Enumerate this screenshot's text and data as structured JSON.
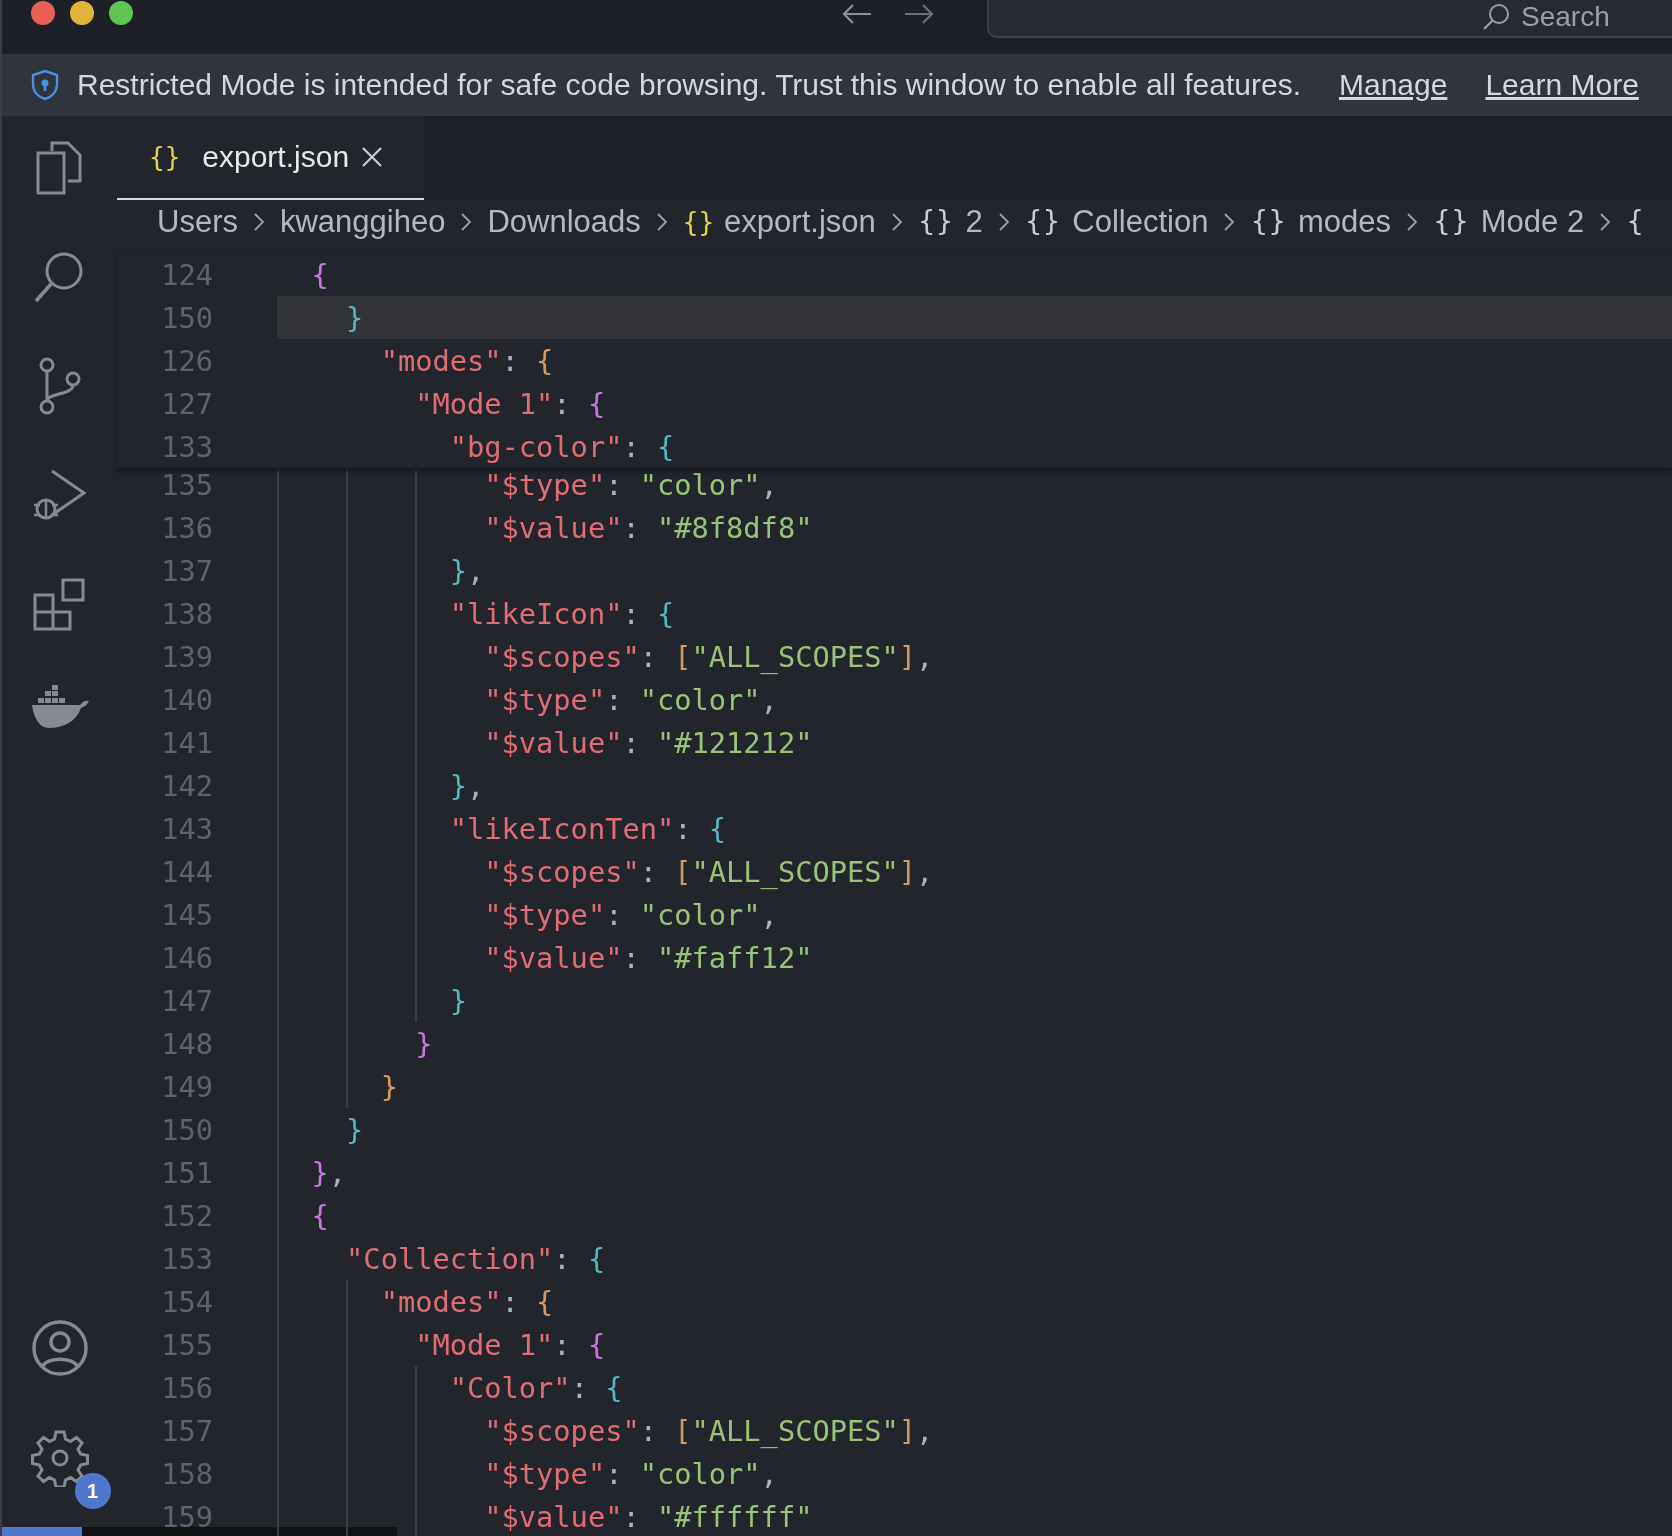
{
  "title_bar": {
    "search": {
      "placeholder": "Search"
    }
  },
  "banner": {
    "message": "Restricted Mode is intended for safe code browsing. Trust this window to enable all features.",
    "links": [
      "Manage",
      "Learn More"
    ]
  },
  "activity_bar": {
    "badge": "1"
  },
  "tabs": [
    {
      "icon": "{}",
      "label": "export.json",
      "selected": true
    }
  ],
  "breadcrumb": [
    {
      "kind": "folder",
      "label": "Users"
    },
    {
      "kind": "folder",
      "label": "kwanggiheo"
    },
    {
      "kind": "folder",
      "label": "Downloads"
    },
    {
      "kind": "file",
      "icon": "{}",
      "label": "export.json"
    },
    {
      "kind": "symbol",
      "icon": "{}",
      "label": "2"
    },
    {
      "kind": "symbol",
      "icon": "{}",
      "label": "Collection"
    },
    {
      "kind": "symbol",
      "icon": "{}",
      "label": "modes"
    },
    {
      "kind": "symbol",
      "icon": "{}",
      "label": "Mode 2"
    },
    {
      "kind": "symbol",
      "icon": "{"
    }
  ],
  "sticky_scroll": [
    {
      "number": "124",
      "current": false,
      "tokens": [
        {
          "kind": "brace",
          "text": "  {",
          "color": "#c678dd"
        }
      ]
    },
    {
      "number": "150",
      "current": true,
      "tokens": [
        {
          "kind": "brace",
          "text": "    }",
          "color": "#56b6c2"
        }
      ]
    },
    {
      "number": "126",
      "current": false,
      "tokens": [
        {
          "kind": "key",
          "text": "      \"modes\""
        },
        {
          "kind": "punct",
          "text": ": "
        },
        {
          "kind": "brace",
          "text": "{",
          "color": "#d19a66"
        }
      ]
    },
    {
      "number": "127",
      "current": false,
      "tokens": [
        {
          "kind": "key",
          "text": "        \"Mode 1\""
        },
        {
          "kind": "punct",
          "text": ": "
        },
        {
          "kind": "brace",
          "text": "{",
          "color": "#c678dd"
        }
      ]
    },
    {
      "number": "133",
      "current": false,
      "tokens": [
        {
          "kind": "key",
          "text": "          \"bg-color\""
        },
        {
          "kind": "punct",
          "text": ": "
        },
        {
          "kind": "brace",
          "text": "{",
          "color": "#56b6c2"
        }
      ]
    }
  ],
  "lines": [
    {
      "number": "135",
      "tokens": [
        {
          "kind": "key",
          "text": "            \"$type\""
        },
        {
          "kind": "punct",
          "text": ": "
        },
        {
          "kind": "string",
          "text": "\"color\""
        },
        {
          "kind": "punct",
          "text": ","
        }
      ]
    },
    {
      "number": "136",
      "tokens": [
        {
          "kind": "key",
          "text": "            \"$value\""
        },
        {
          "kind": "punct",
          "text": ": "
        },
        {
          "kind": "string",
          "text": "\"#8f8df8\""
        }
      ]
    },
    {
      "number": "137",
      "tokens": [
        {
          "kind": "brace",
          "text": "          }",
          "color": "#56b6c2"
        },
        {
          "kind": "punct",
          "text": ","
        }
      ]
    },
    {
      "number": "138",
      "tokens": [
        {
          "kind": "key",
          "text": "          \"likeIcon\""
        },
        {
          "kind": "punct",
          "text": ": "
        },
        {
          "kind": "brace",
          "text": "{",
          "color": "#56b6c2"
        }
      ]
    },
    {
      "number": "139",
      "tokens": [
        {
          "kind": "key",
          "text": "            \"$scopes\""
        },
        {
          "kind": "punct",
          "text": ": "
        },
        {
          "kind": "brace",
          "text": "[",
          "color": "#d19a66"
        },
        {
          "kind": "string",
          "text": "\"ALL_SCOPES\""
        },
        {
          "kind": "brace",
          "text": "]",
          "color": "#d19a66"
        },
        {
          "kind": "punct",
          "text": ","
        }
      ]
    },
    {
      "number": "140",
      "tokens": [
        {
          "kind": "key",
          "text": "            \"$type\""
        },
        {
          "kind": "punct",
          "text": ": "
        },
        {
          "kind": "string",
          "text": "\"color\""
        },
        {
          "kind": "punct",
          "text": ","
        }
      ]
    },
    {
      "number": "141",
      "tokens": [
        {
          "kind": "key",
          "text": "            \"$value\""
        },
        {
          "kind": "punct",
          "text": ": "
        },
        {
          "kind": "string",
          "text": "\"#121212\""
        }
      ]
    },
    {
      "number": "142",
      "tokens": [
        {
          "kind": "brace",
          "text": "          }",
          "color": "#56b6c2"
        },
        {
          "kind": "punct",
          "text": ","
        }
      ]
    },
    {
      "number": "143",
      "tokens": [
        {
          "kind": "key",
          "text": "          \"likeIconTen\""
        },
        {
          "kind": "punct",
          "text": ": "
        },
        {
          "kind": "brace",
          "text": "{",
          "color": "#56b6c2"
        }
      ]
    },
    {
      "number": "144",
      "tokens": [
        {
          "kind": "key",
          "text": "            \"$scopes\""
        },
        {
          "kind": "punct",
          "text": ": "
        },
        {
          "kind": "brace",
          "text": "[",
          "color": "#d19a66"
        },
        {
          "kind": "string",
          "text": "\"ALL_SCOPES\""
        },
        {
          "kind": "brace",
          "text": "]",
          "color": "#d19a66"
        },
        {
          "kind": "punct",
          "text": ","
        }
      ]
    },
    {
      "number": "145",
      "tokens": [
        {
          "kind": "key",
          "text": "            \"$type\""
        },
        {
          "kind": "punct",
          "text": ": "
        },
        {
          "kind": "string",
          "text": "\"color\""
        },
        {
          "kind": "punct",
          "text": ","
        }
      ]
    },
    {
      "number": "146",
      "tokens": [
        {
          "kind": "key",
          "text": "            \"$value\""
        },
        {
          "kind": "punct",
          "text": ": "
        },
        {
          "kind": "string",
          "text": "\"#faff12\""
        }
      ]
    },
    {
      "number": "147",
      "tokens": [
        {
          "kind": "brace",
          "text": "          }",
          "color": "#56b6c2"
        }
      ]
    },
    {
      "number": "148",
      "tokens": [
        {
          "kind": "brace",
          "text": "        }",
          "color": "#c678dd"
        }
      ]
    },
    {
      "number": "149",
      "tokens": [
        {
          "kind": "brace",
          "text": "      }",
          "color": "#d19a66"
        }
      ]
    },
    {
      "number": "150",
      "tokens": [
        {
          "kind": "brace",
          "text": "    }",
          "color": "#56b6c2"
        }
      ]
    },
    {
      "number": "151",
      "tokens": [
        {
          "kind": "brace",
          "text": "  }",
          "color": "#c678dd"
        },
        {
          "kind": "punct",
          "text": ","
        }
      ]
    },
    {
      "number": "152",
      "tokens": [
        {
          "kind": "brace",
          "text": "  {",
          "color": "#c678dd"
        }
      ]
    },
    {
      "number": "153",
      "tokens": [
        {
          "kind": "key",
          "text": "    \"Collection\""
        },
        {
          "kind": "punct",
          "text": ": "
        },
        {
          "kind": "brace",
          "text": "{",
          "color": "#56b6c2"
        }
      ]
    },
    {
      "number": "154",
      "tokens": [
        {
          "kind": "key",
          "text": "      \"modes\""
        },
        {
          "kind": "punct",
          "text": ": "
        },
        {
          "kind": "brace",
          "text": "{",
          "color": "#d19a66"
        }
      ]
    },
    {
      "number": "155",
      "tokens": [
        {
          "kind": "key",
          "text": "        \"Mode 1\""
        },
        {
          "kind": "punct",
          "text": ": "
        },
        {
          "kind": "brace",
          "text": "{",
          "color": "#c678dd"
        }
      ]
    },
    {
      "number": "156",
      "tokens": [
        {
          "kind": "key",
          "text": "          \"Color\""
        },
        {
          "kind": "punct",
          "text": ": "
        },
        {
          "kind": "brace",
          "text": "{",
          "color": "#56b6c2"
        }
      ]
    },
    {
      "number": "157",
      "tokens": [
        {
          "kind": "key",
          "text": "            \"$scopes\""
        },
        {
          "kind": "punct",
          "text": ": "
        },
        {
          "kind": "brace",
          "text": "[",
          "color": "#d19a66"
        },
        {
          "kind": "string",
          "text": "\"ALL_SCOPES\""
        },
        {
          "kind": "brace",
          "text": "]",
          "color": "#d19a66"
        },
        {
          "kind": "punct",
          "text": ","
        }
      ]
    },
    {
      "number": "158",
      "tokens": [
        {
          "kind": "key",
          "text": "            \"$type\""
        },
        {
          "kind": "punct",
          "text": ": "
        },
        {
          "kind": "string",
          "text": "\"color\""
        },
        {
          "kind": "punct",
          "text": ","
        }
      ]
    },
    {
      "number": "159",
      "tokens": [
        {
          "kind": "key",
          "text": "            \"$value\""
        },
        {
          "kind": "punct",
          "text": ": "
        },
        {
          "kind": "string",
          "text": "\"#ffffff\""
        }
      ]
    }
  ]
}
